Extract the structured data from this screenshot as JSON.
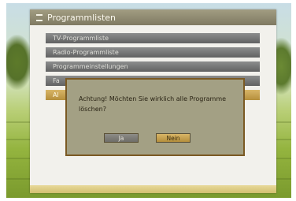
{
  "window": {
    "title": "Programmlisten"
  },
  "menu": {
    "items": [
      {
        "label": "TV-Programmliste"
      },
      {
        "label": "Radio-Programmliste"
      },
      {
        "label": "Programmeinstellungen"
      },
      {
        "label": "Fa"
      },
      {
        "label": "Al"
      }
    ],
    "selected_index": 4
  },
  "dialog": {
    "message": "Achtung! Möchten Sie wirklich alle Programme löschen?",
    "yes_label": "Ja",
    "no_label": "Nein",
    "focused_button": "Nein"
  },
  "colors": {
    "header": "#8f8a70",
    "selected": "#c9a551",
    "dialog_bg": "#a3a084",
    "dialog_border": "#7b5a23"
  }
}
